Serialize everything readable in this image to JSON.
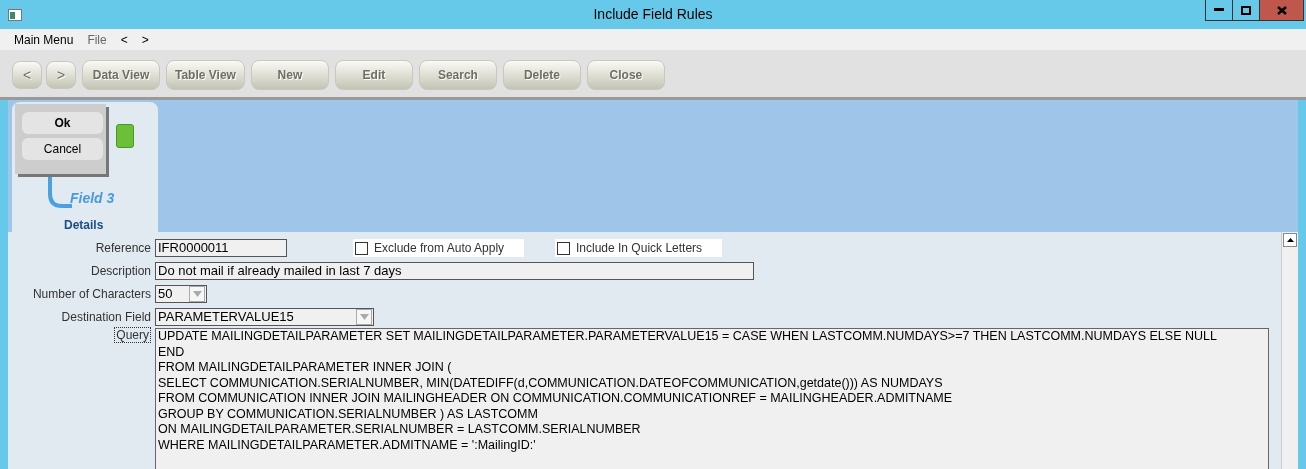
{
  "window": {
    "title": "Include Field Rules"
  },
  "menu": [
    "Main Menu",
    "File",
    "<",
    ">"
  ],
  "toolbar": [
    {
      "label": "<",
      "kind": "nav",
      "disabled": true
    },
    {
      "label": ">",
      "kind": "nav",
      "disabled": true
    },
    {
      "label": "Data View",
      "kind": "action",
      "disabled": true
    },
    {
      "label": "Table View",
      "kind": "action",
      "disabled": true
    },
    {
      "label": "**N**ew",
      "kind": "action",
      "disabled": true
    },
    {
      "label": "**E**dit",
      "kind": "action",
      "disabled": true
    },
    {
      "label": "**S**earch",
      "kind": "action",
      "disabled": true
    },
    {
      "label": "**D**elete",
      "kind": "action",
      "disabled": true
    },
    {
      "label": "**C**lose",
      "kind": "action",
      "disabled": true
    }
  ],
  "popup": {
    "items": [
      {
        "label": "**O**k",
        "default": true
      },
      {
        "label": "Cancel",
        "default": false
      }
    ]
  },
  "tree": {
    "items": [
      "Field 3"
    ],
    "tab": "Details"
  },
  "form": {
    "reference": {
      "label": "Reference",
      "value": "IFR0000011"
    },
    "checkboxes": [
      {
        "label": "Exclude from Auto Apply",
        "checked": false
      },
      {
        "label": "Include In Quick Letters",
        "checked": false
      }
    ],
    "description": {
      "label": "Description",
      "value": "Do not mail if already mailed in last 7 days"
    },
    "characters": {
      "label": "Number of Characters",
      "value": "50"
    },
    "destination": {
      "label": "Destination Field",
      "value": "PARAMETERVALUE15"
    },
    "query": {
      "label": "Query",
      "lines": [
        "UPDATE MAILINGDETAILPARAMETER SET MAILINGDETAILPARAMETER.PARAMETERVALUE15 = CASE WHEN LASTCOMM.NUMDAYS>=7 THEN LASTCOMM.NUMDAYS ELSE NULL",
        "END",
        "FROM MAILINGDETAILPARAMETER INNER JOIN (",
        "SELECT COMMUNICATION.SERIALNUMBER, MIN(DATEDIFF(d,COMMUNICATION.DATEOFCOMMUNICATION,getdate())) AS NUMDAYS",
        "FROM COMMUNICATION INNER JOIN MAILINGHEADER ON COMMUNICATION.COMMUNICATIONREF = MAILINGHEADER.ADMITNAME",
        "GROUP BY COMMUNICATION.SERIALNUMBER ) AS LASTCOMM",
        "ON MAILINGDETAILPARAMETER.SERIALNUMBER = LASTCOMM.SERIALNUMBER",
        "WHERE MAILINGDETAILPARAMETER.ADMITNAME = ':MailingID:'"
      ]
    }
  }
}
